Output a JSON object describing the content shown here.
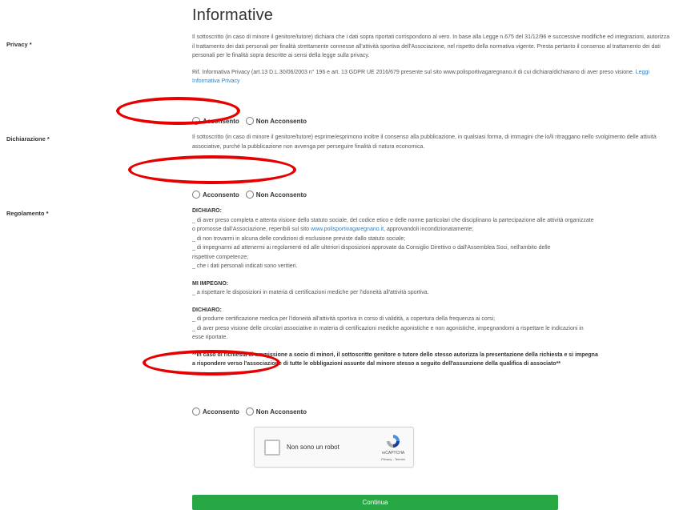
{
  "title": "Informative",
  "privacy": {
    "label": "Privacy *",
    "para1": "Il sottoscritto (in caso di minore il genitore/tutore) dichiara che i dati sopra riportati corrispondono al vero. In base alla Legge n.675 del 31/12/96 e successive modifiche ed integrazioni, autorizza il trattamento dei dati personali per finalità strettamente connesse all'attività sportiva dell'Associazione, nel rispetto della normativa vigente.  Presta pertanto il consenso al trattamento dei dati personali per le finalità sopra descritte ai sensi della legge sulla privacy.",
    "para2": "Rif. Informativa Privacy (art.13 D.L.30/06/2003 n° 196 e art. 13 GDPR UE 2016/679 presente sul sito www.polisportivagaregnano.it di cui dichiara/dichiarano di aver preso visione.",
    "link": "Leggi Informativa Privacy",
    "opt_yes": "Acconsento",
    "opt_no": "Non Acconsento"
  },
  "dichiarazione": {
    "label": "Dichiarazione *",
    "para": "Il sottoscritto (in caso di minore il genitore/tutore) esprime/esprimono inoltre il consenso alla pubblicazione, in qualsiasi forma, di immagini che lo/li ritraggano nello svolgimento delle attività associative, purché la pubblicazione non avvenga per perseguire finalità di natura economica.",
    "opt_yes": "Acconsento",
    "opt_no": "Non Acconsento"
  },
  "regolamento": {
    "label": "Regolamento *",
    "h1": "DICHIARO:",
    "l1a": "_ di aver preso completa e attenta visione dello statuto sociale, del codice etico e delle norme particolari che disciplinano la partecipazione alle attività organizzate",
    "l1b_pre": "o promosse dall'Associazione, reperibili sul sito ",
    "l1b_link": "www.polisportivagaregnano.it",
    "l1b_post": ", approvandoli incondizionatamente;",
    "l2": "_ di non trovarmi in alcuna delle condizioni di esclusione previste dallo statuto sociale;",
    "l3a": "_ di impegnarmi ad attenermi ai regolamenti ed alle ulteriori disposizioni approvate da Consiglio Direttivo o dall'Assemblea Soci, nell'ambito delle",
    "l3b": "rispettive competenze;",
    "l4": "_ che i dati personali indicati sono veritieri.",
    "h2": "MI IMPEGNO:",
    "l5": "_ a rispettare le disposizioni in materia di certificazioni mediche per l'idoneità all'attività sportiva.",
    "h3": "DICHIARO:",
    "l6": "_ di produrre certificazione medica per l'idoneità all'attività sportiva in corso di validità, a copertura della frequenza ai corsi;",
    "l7a": "_ di aver preso visione delle circolari associative in materia di certificazioni mediche agonistiche e non agonistiche, impegnandomi a rispettare le indicazioni in",
    "l7b": "esse riportate.",
    "bold1": "**In caso di richiesta di ammissione a socio di minori, il sottoscritto genitore o tutore dello stesso autorizza la presentazione della richiesta e si impegna",
    "bold2": "a rispondere verso l'associazione di tutte le obbligazioni assunte dal minore stesso a seguito dell'assunzione della qualifica di associato**",
    "opt_yes": "Acconsento",
    "opt_no": "Non Acconsento"
  },
  "captcha": {
    "label": "Non sono un robot",
    "brand": "reCAPTCHA",
    "links": "Privacy - Termini"
  },
  "submit": "Continua",
  "colors": {
    "annotation": "#e60000",
    "button": "#28a745",
    "link": "#2f7fbf"
  }
}
